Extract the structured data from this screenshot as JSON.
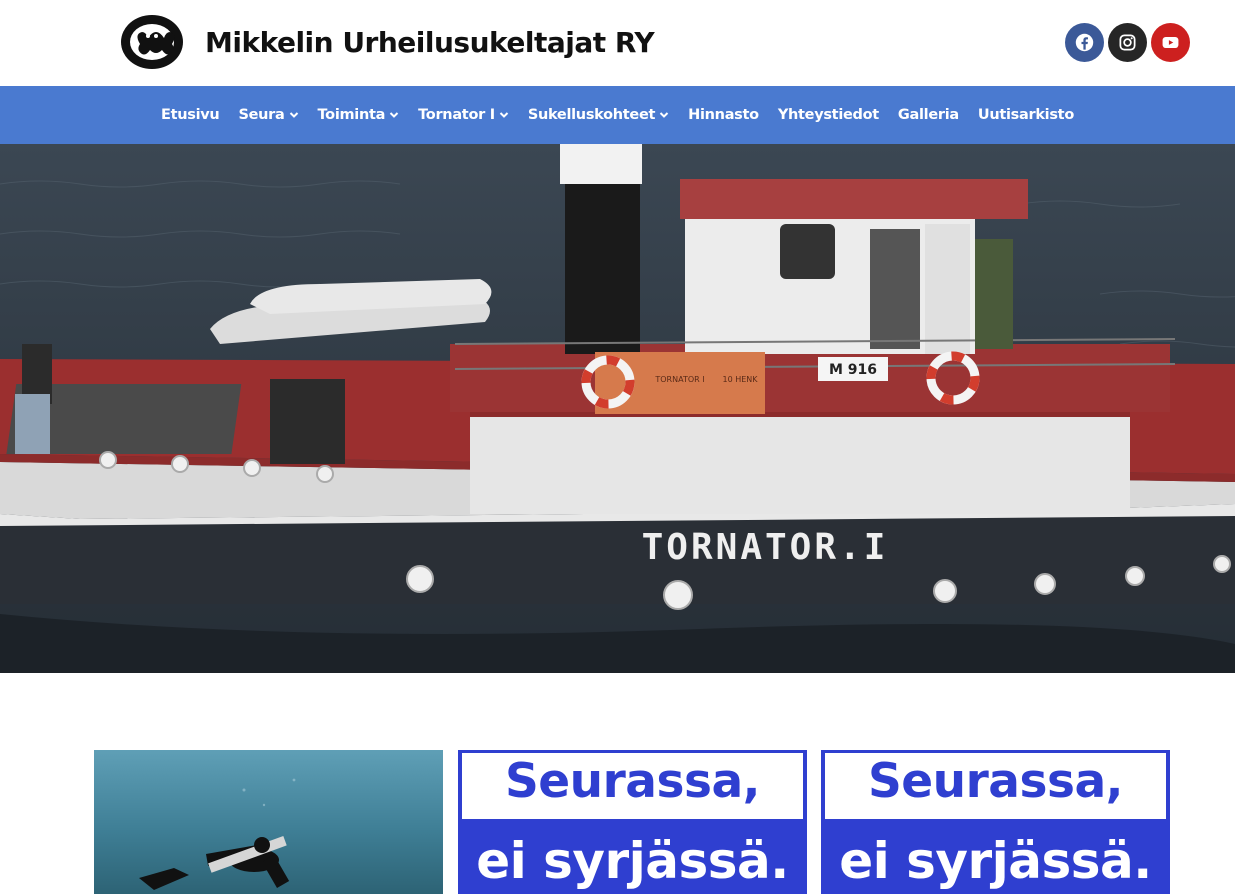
{
  "header": {
    "site_title": "Mikkelin Urheilusukeltajat RY",
    "logo_icon": "frog-logo-icon",
    "social": [
      {
        "name": "facebook-icon",
        "color": "#3b5998"
      },
      {
        "name": "instagram-icon",
        "color": "#262626"
      },
      {
        "name": "youtube-icon",
        "color": "#cd201f"
      }
    ]
  },
  "nav": {
    "background": "#4a7ad0",
    "items": [
      {
        "label": "Etusivu",
        "dropdown": false
      },
      {
        "label": "Seura",
        "dropdown": true
      },
      {
        "label": "Toiminta",
        "dropdown": true
      },
      {
        "label": "Tornator I",
        "dropdown": true
      },
      {
        "label": "Sukelluskohteet",
        "dropdown": true
      },
      {
        "label": "Hinnasto",
        "dropdown": false
      },
      {
        "label": "Yhteystiedot",
        "dropdown": false
      },
      {
        "label": "Galleria",
        "dropdown": false
      },
      {
        "label": "Uutisarkisto",
        "dropdown": false
      }
    ]
  },
  "hero": {
    "boat_name": "TORNATOR.I",
    "registration": "M 916",
    "board_text": "TORNATOR I",
    "board_text2": "10 HENK"
  },
  "cards": {
    "banner1": {
      "line1": "Seurassa,",
      "line2": "ei syrjässä."
    },
    "banner2": {
      "line1": "Seurassa,",
      "line2": "ei syrjässä."
    }
  }
}
